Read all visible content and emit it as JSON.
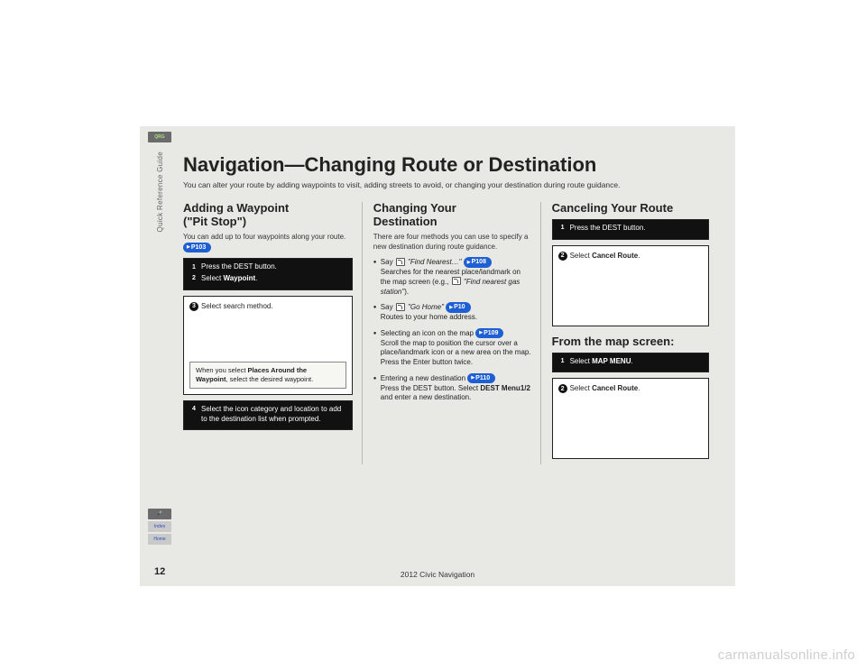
{
  "sidebar": {
    "qrg": "QRG",
    "vert_label": "Quick Reference Guide",
    "voice": "🎤",
    "index": "Index",
    "home": "Home",
    "page_num": "12"
  },
  "title": "Navigation—Changing Route or Destination",
  "intro": "You can alter your route by adding waypoints to visit, adding streets to avoid, or changing your destination during route guidance.",
  "col1": {
    "h2a": "Adding a Waypoint",
    "h2b": "(\"Pit Stop\")",
    "body": "You can add up to four waypoints along your route. ",
    "pill": "P103",
    "box1_step1": "Press the DEST button.",
    "box1_step2_pre": "Select ",
    "box1_step2_b": "Waypoint",
    "box1_step2_post": ".",
    "box2_step3": "Select search method.",
    "box2_note_pre": "When you select ",
    "box2_note_b": "Places Around the Waypoint",
    "box2_note_post": ", select the desired waypoint.",
    "box3_step4": "Select the icon category and location to add to the destination list when prompted."
  },
  "col2": {
    "h2a": "Changing Your",
    "h2b": "Destination",
    "body": "There are four methods you can use to specify a new destination during route guidance.",
    "b1_pre": "Say ",
    "b1_q": "\"Find Nearest…\"",
    "b1_pill": "P108",
    "b1_line2a": "Searches for the nearest place/landmark on the map screen (e.g., ",
    "b1_line2q": "\"Find nearest gas station\"",
    "b1_line2b": ").",
    "b2_pre": "Say ",
    "b2_q": "\"Go Home\"",
    "b2_pill": "P10",
    "b2_line2": "Routes to your home address.",
    "b3_pre": "Selecting an icon on the map ",
    "b3_pill": "P109",
    "b3_line2": "Scroll the map to position the cursor over a place/landmark icon or a new area on the map. Press the Enter button twice.",
    "b4_pre": "Entering a new destination ",
    "b4_pill": "P110",
    "b4_line2a": "Press the DEST button. Select ",
    "b4_line2b": "DEST Menu1/2",
    "b4_line2c": " and enter a new destination."
  },
  "col3": {
    "h2": "Canceling Your Route",
    "box1_step1": "Press the DEST button.",
    "box2_step2_pre": "Select ",
    "box2_step2_b": "Cancel Route",
    "box2_step2_post": ".",
    "h2b": "From the map screen:",
    "box3_step1_pre": "Select ",
    "box3_step1_b": "MAP MENU",
    "box3_step1_post": ".",
    "box4_step2_pre": "Select ",
    "box4_step2_b": "Cancel Route",
    "box4_step2_post": "."
  },
  "footer": "2012 Civic Navigation",
  "watermark": "carmanualsonline.info"
}
